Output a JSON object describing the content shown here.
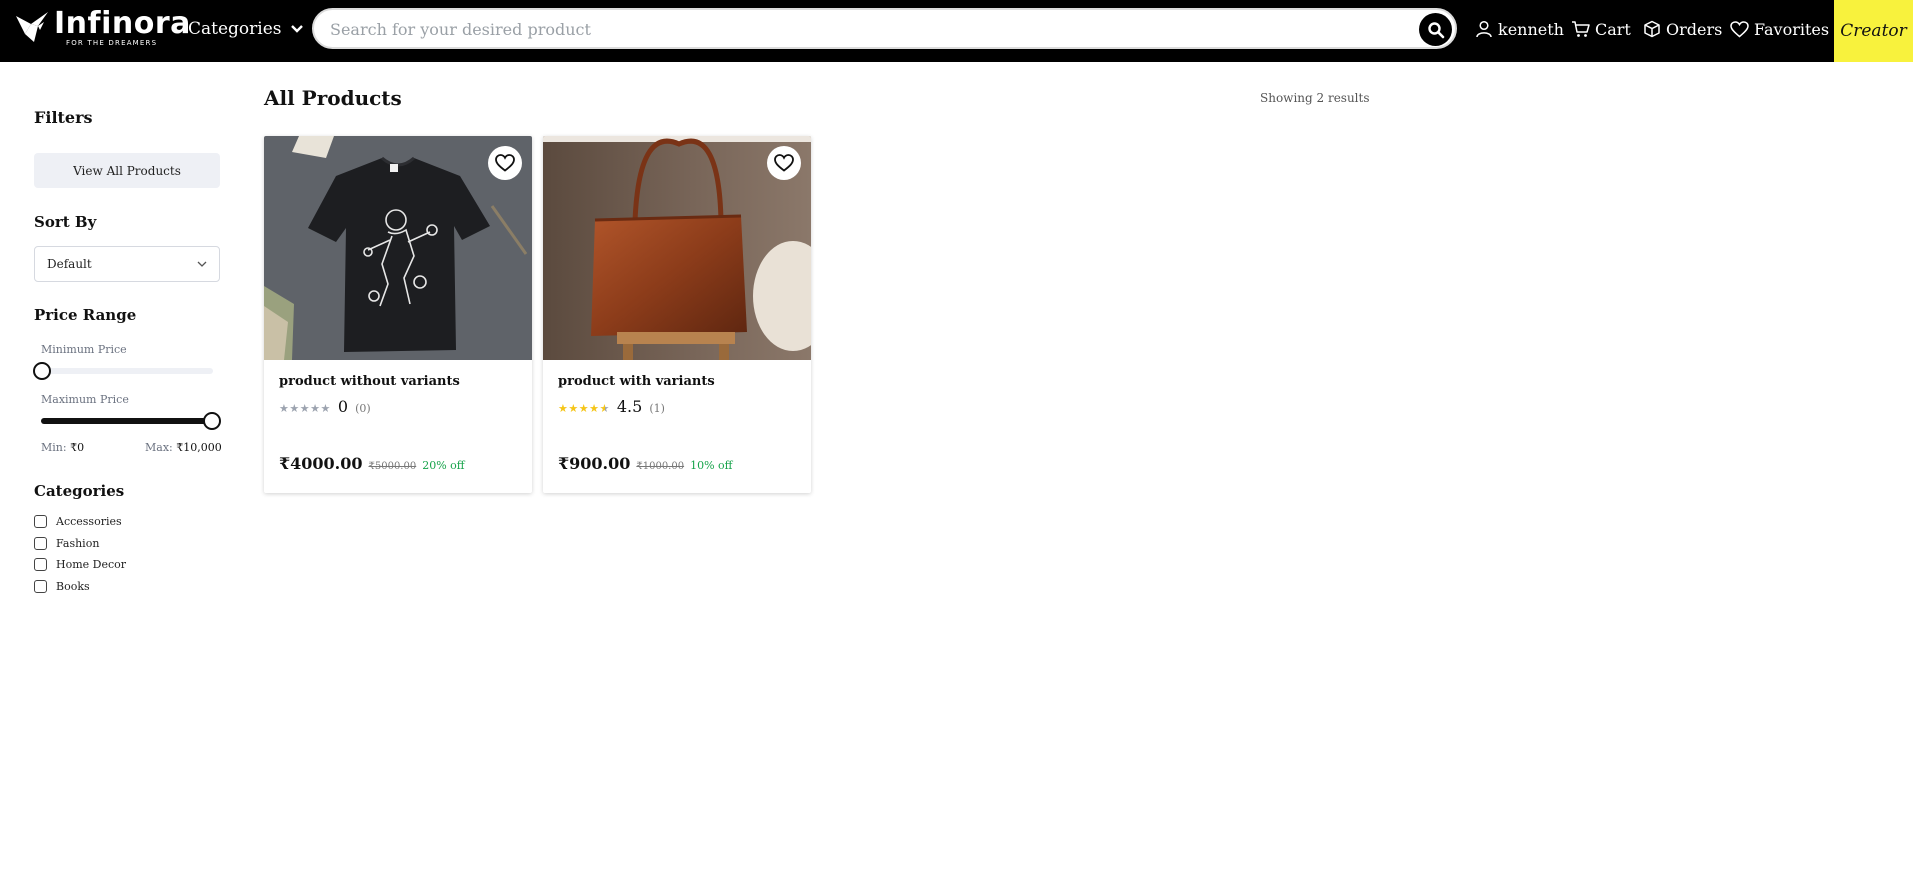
{
  "header": {
    "logo_title": "Infinora",
    "logo_tagline": "FOR THE DREAMERS",
    "categories_label": "Categories",
    "search_placeholder": "Search for your desired product",
    "user_label": "kenneth",
    "cart_label": "Cart",
    "orders_label": "Orders",
    "favorites_label": "Favorites",
    "creator_label": "Creator",
    "creator_color": "#f8f23d"
  },
  "sidebar": {
    "filters_title": "Filters",
    "view_all_label": "View All Products",
    "sort_title": "Sort By",
    "sort_selected": "Default",
    "price_title": "Price Range",
    "min_price_label": "Minimum Price",
    "max_price_label": "Maximum Price",
    "min_prefix": "Min:",
    "min_value": "₹0",
    "max_prefix": "Max:",
    "max_value": "₹10,000",
    "min_slider_fraction": 0,
    "max_slider_fraction": 1,
    "categories_title": "Categories",
    "categories": [
      "Accessories",
      "Fashion",
      "Home Decor",
      "Books"
    ]
  },
  "main": {
    "title": "All Products",
    "results_text": "Showing 2 results",
    "products": [
      {
        "name": "product without variants",
        "stars": 0,
        "rating": "0",
        "reviews": "(0)",
        "price": "₹4000.00",
        "original_price": "₹5000.00",
        "discount": "20% off",
        "image": "black-astronaut-tshirt"
      },
      {
        "name": "product with variants",
        "stars": 4.5,
        "rating": "4.5",
        "reviews": "(1)",
        "price": "₹900.00",
        "original_price": "₹1000.00",
        "discount": "10% off",
        "image": "brown-leather-tote-bag"
      }
    ]
  },
  "colors": {
    "header_bg": "#000000",
    "discount_green": "#16a34a",
    "star_gold": "#f5c518",
    "star_empty": "#9ca3af"
  }
}
